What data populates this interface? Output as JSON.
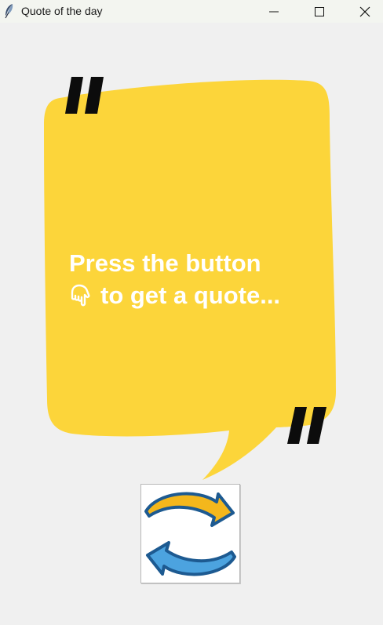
{
  "window": {
    "title": "Quote of the day",
    "app_icon": "feather-icon",
    "controls": [
      "minimize-icon",
      "maximize-icon",
      "close-icon"
    ]
  },
  "quote": {
    "line1": "Press the button",
    "line2": "to get a quote...",
    "inline_icon": "pointing-down-hand-icon",
    "bubble_color": "#fcd53a",
    "text_color": "#ffffff"
  },
  "refresh_button": {
    "icon": "refresh-arrows-icon",
    "top_arrow_color": "#f4b71c",
    "bottom_arrow_color": "#4ca3df",
    "outline_color": "#1d5a91"
  }
}
